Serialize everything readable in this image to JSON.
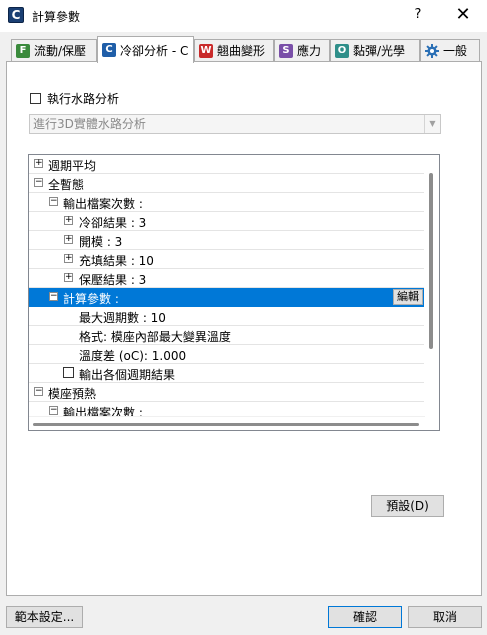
{
  "window": {
    "title": "計算參數",
    "app_icon_letter": "C",
    "help_glyph": "?",
    "close_glyph": "✕"
  },
  "tabs": [
    {
      "label": "流動/保壓",
      "icon": "F",
      "icon_color": "#3a8a3c"
    },
    {
      "label": "冷卻分析 - C",
      "icon": "C",
      "icon_color": "#1f5ea8"
    },
    {
      "label": "翹曲變形",
      "icon": "W",
      "icon_color": "#c92a2a"
    },
    {
      "label": "應力",
      "icon": "S",
      "icon_color": "#7a4fa8"
    },
    {
      "label": "黏彈/光學",
      "icon": "O",
      "icon_color": "#2f8f8a"
    },
    {
      "label": "一般",
      "icon": "gear-icon",
      "icon_color": "#2a6fb5"
    }
  ],
  "run_analysis": {
    "label": "執行水路分析",
    "checked": false
  },
  "analysis_mode": {
    "value": "進行3D實體水路分析"
  },
  "tree": {
    "rows": [
      {
        "text": "週期平均",
        "toggle": "+"
      },
      {
        "text": "全暫態",
        "toggle": "−"
      },
      {
        "text": "輸出檔案次數 :",
        "toggle": "−"
      },
      {
        "text": "冷卻結果 : 3",
        "toggle": "+"
      },
      {
        "text": "開模 : 3",
        "toggle": "+"
      },
      {
        "text": "充填結果 : 10",
        "toggle": "+"
      },
      {
        "text": "保壓結果 : 3",
        "toggle": "+"
      },
      {
        "text": "計算參數 :",
        "toggle": "−",
        "action": "編輯"
      },
      {
        "text": "最大週期數 : 10"
      },
      {
        "text": "格式: 模座內部最大變異溫度"
      },
      {
        "text": "溫度差 (oC): 1.000"
      },
      {
        "text": "輸出各個週期結果",
        "checkbox": false
      },
      {
        "text": "模座預熱",
        "toggle": "−"
      },
      {
        "text": "輸出檔案次數 :",
        "toggle": "−"
      }
    ]
  },
  "buttons": {
    "defaults": "預設(D)",
    "template": "範本設定...",
    "ok": "確認",
    "cancel": "取消"
  }
}
